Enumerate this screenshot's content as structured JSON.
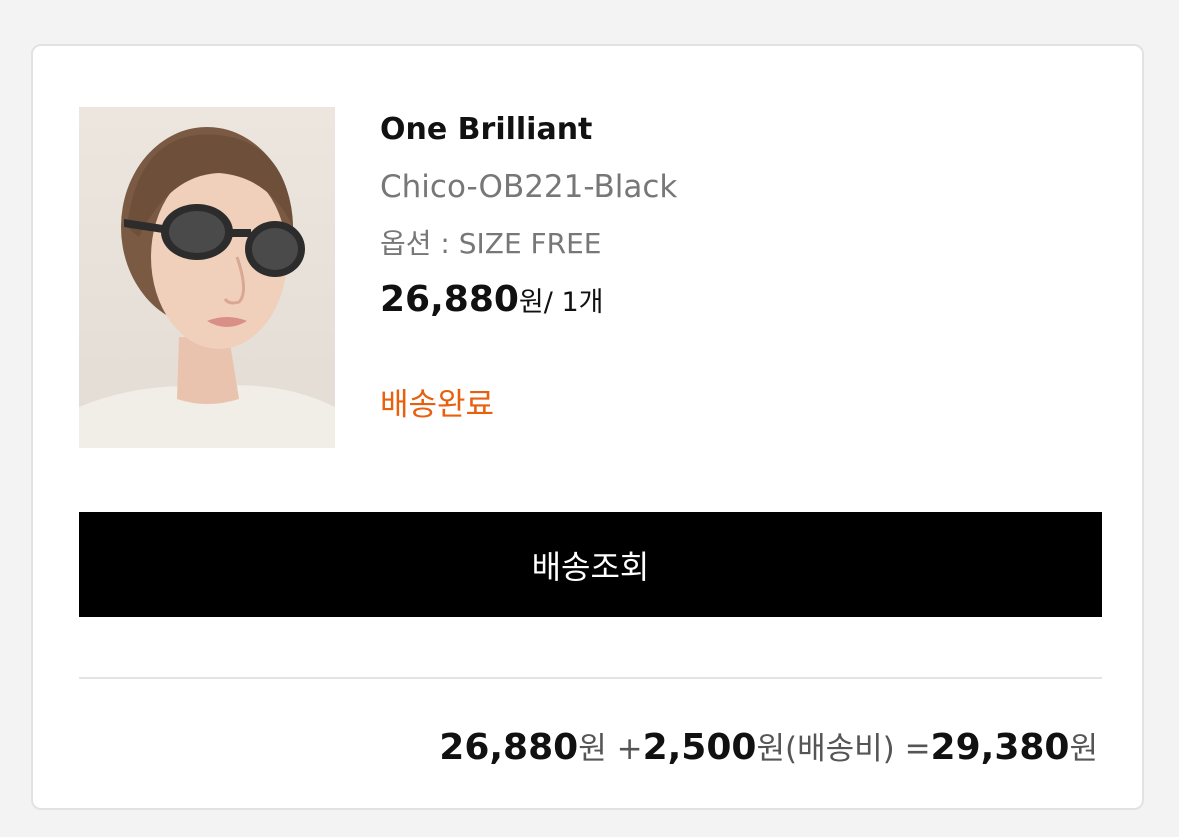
{
  "product": {
    "brand": "One Brilliant",
    "name": "Chico-OB221-Black",
    "option": "옵션 : SIZE FREE",
    "price": "26,880",
    "price_unit": "원",
    "quantity": "/ 1개",
    "status": "배송완료",
    "image_alt": "model-wearing-black-oval-sunglasses"
  },
  "actions": {
    "track_label": "배송조회"
  },
  "summary": {
    "subtotal": "26,880",
    "won1": "원",
    "plus": " +",
    "shipping": "2,500",
    "won2": "원",
    "shipping_label": "(배송비) =",
    "total": "29,380",
    "won3": "원"
  },
  "colors": {
    "status": "#e8600e",
    "button_bg": "#000000"
  }
}
